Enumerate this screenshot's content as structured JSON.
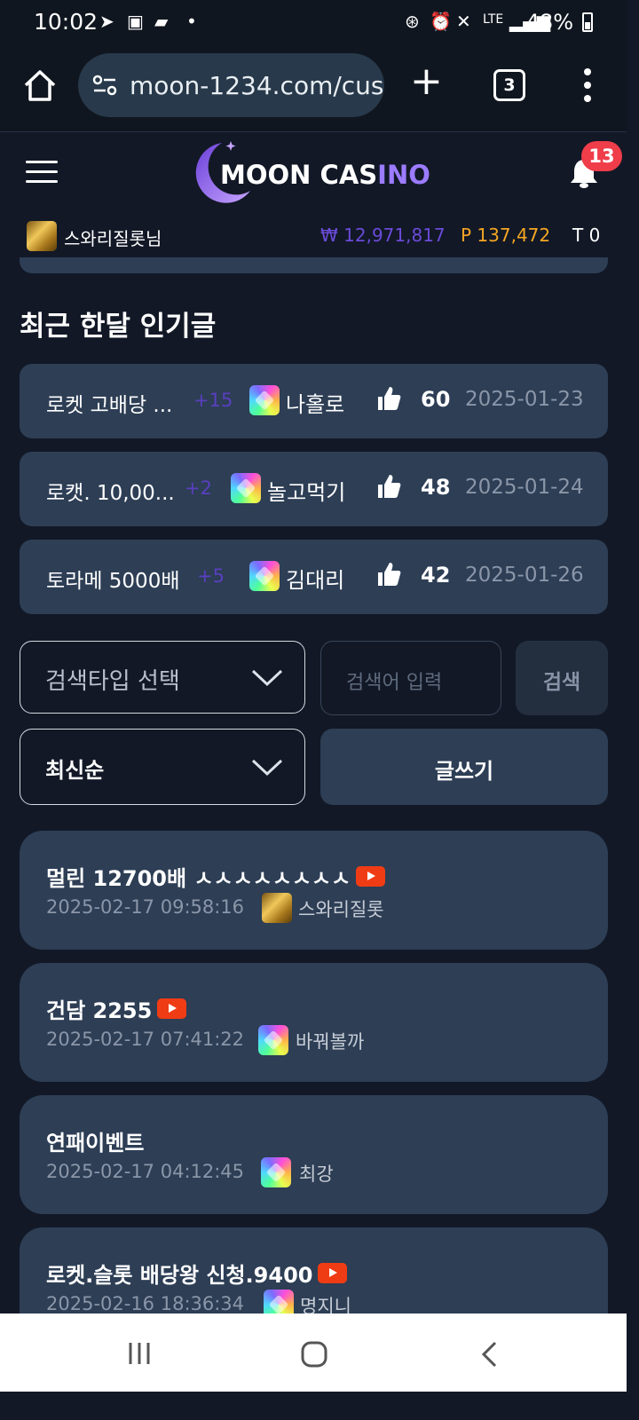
{
  "status_bar": {
    "time": "10:02",
    "battery": "48%"
  },
  "browser": {
    "url": "moon-1234.com/cus",
    "tab_count": "3"
  },
  "header": {
    "logo_text_1": "MOON CAS",
    "logo_text_2": "INO",
    "notification_count": "13"
  },
  "user": {
    "name": "스와리질롯님",
    "balance": "₩ 12,971,817",
    "points": "P 137,472",
    "tickets": "T 0"
  },
  "section_title": "최근 한달 인기글",
  "popular_posts": [
    {
      "title": "로켓 고배당 ...",
      "comments": "+15",
      "author": "나홀로",
      "likes": "60",
      "date": "2025-01-23"
    },
    {
      "title": "로캣. 10,00...",
      "comments": "+2",
      "author": "놀고먹기",
      "likes": "48",
      "date": "2025-01-24"
    },
    {
      "title": "토라메 5000배",
      "comments": "+5",
      "author": "김대리",
      "likes": "42",
      "date": "2025-01-26"
    }
  ],
  "search": {
    "type_select": "검색타입 선택",
    "placeholder": "검색어 입력",
    "button": "검색"
  },
  "sort": {
    "selected": "최신순"
  },
  "write_button": "글쓰기",
  "posts": [
    {
      "title": "멀린 12700배 ㅅㅅㅅㅅㅅㅅㅅㅅ",
      "video": true,
      "datetime": "2025-02-17 09:58:16",
      "author": "스와리질롯",
      "avatar": "gold"
    },
    {
      "title": "건담 2255",
      "video": true,
      "datetime": "2025-02-17 07:41:22",
      "author": "바꿔볼까",
      "avatar": "rainbow"
    },
    {
      "title": "연패이벤트",
      "video": false,
      "datetime": "2025-02-17 04:12:45",
      "author": "최강",
      "avatar": "rainbow"
    },
    {
      "title": "로켓.슬롯 배당왕 신청.9400",
      "video": true,
      "datetime": "2025-02-16 18:36:34",
      "author": "명지니",
      "avatar": "rainbow"
    }
  ],
  "colors": {
    "background": "#121826",
    "card": "#2d3e55",
    "balance": "#6a4bd8",
    "points": "#f5a623",
    "badge": "#ef3d4a",
    "youtube": "#f03c14"
  }
}
